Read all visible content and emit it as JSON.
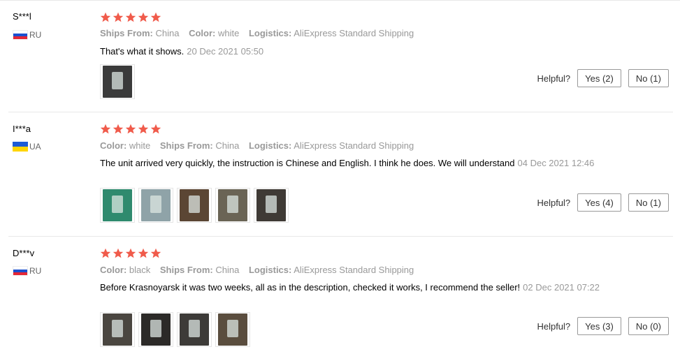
{
  "reviews": [
    {
      "user": "S***l",
      "country": "RU",
      "flag": "russia-flag",
      "rating": 5,
      "attributes": [
        {
          "key": "Ships From:",
          "value": "China"
        },
        {
          "key": "Color:",
          "value": "white"
        },
        {
          "key": "Logistics:",
          "value": "AliExpress Standard Shipping"
        }
      ],
      "text": "That's what it shows.",
      "date": "20 Dec 2021 05:50",
      "photos": [
        "#3a3a3a"
      ],
      "helpful_label": "Helpful?",
      "yes_label": "Yes (2)",
      "no_label": "No (1)"
    },
    {
      "user": "I***a",
      "country": "UA",
      "flag": "ukraine-flag",
      "rating": 5,
      "attributes": [
        {
          "key": "Color:",
          "value": "white"
        },
        {
          "key": "Ships From:",
          "value": "China"
        },
        {
          "key": "Logistics:",
          "value": "AliExpress Standard Shipping"
        }
      ],
      "text": "The unit arrived very quickly, the instruction is Chinese and English. I think he does. We will understand",
      "date": "04 Dec 2021 12:46",
      "photos": [
        "#2f8a6e",
        "#c9d3d6",
        "#5b4634",
        "#6a6455",
        "#3f3a35"
      ],
      "helpful_label": "Helpful?",
      "yes_label": "Yes (4)",
      "no_label": "No (1)"
    },
    {
      "user": "D***v",
      "country": "RU",
      "flag": "russia-flag",
      "rating": 5,
      "attributes": [
        {
          "key": "Color:",
          "value": "black"
        },
        {
          "key": "Ships From:",
          "value": "China"
        },
        {
          "key": "Logistics:",
          "value": "AliExpress Standard Shipping"
        }
      ],
      "text": "Before Krasnoyarsk it was two weeks, all as in the description, checked it works, I recommend the seller!",
      "date": "02 Dec 2021 07:22",
      "photos": [
        "#4a4640",
        "#2c2a28",
        "#3d3b38",
        "#5a4d3e"
      ],
      "helpful_label": "Helpful?",
      "yes_label": "Yes (3)",
      "no_label": "No (0)"
    }
  ],
  "colors": {
    "star": "#f05b4b",
    "muted": "#999999",
    "border": "#e8e8e8"
  }
}
